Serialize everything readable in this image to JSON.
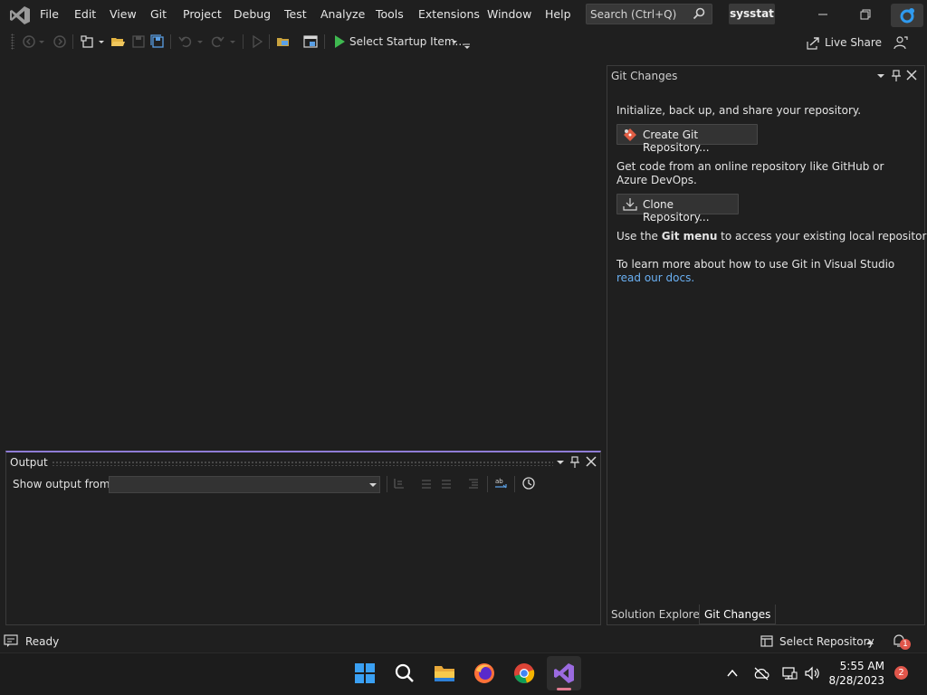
{
  "menu": {
    "items": [
      "File",
      "Edit",
      "View",
      "Git",
      "Project",
      "Debug",
      "Test",
      "Analyze",
      "Tools",
      "Extensions",
      "Window",
      "Help"
    ]
  },
  "search": {
    "label": "Search (Ctrl+Q)"
  },
  "solution_name": "sysstat",
  "toolbar": {
    "run_label": "Select Startup Item...",
    "live_share_label": "Live Share"
  },
  "git_panel": {
    "title": "Git Changes",
    "intro_text": "Initialize, back up, and share your repository.",
    "create_button": "Create Git Repository...",
    "clone_intro": "Get code from an online repository like GitHub or Azure DevOps.",
    "clone_button": "Clone Repository...",
    "menu_text_prefix": "Use the ",
    "menu_text_bold": "Git menu",
    "menu_text_suffix": " to access your existing local repositories.",
    "learn_text": "To learn more about how to use Git in Visual Studio",
    "docs_link": "read our docs.",
    "tabs": [
      "Solution Explorer",
      "Git Changes"
    ],
    "active_tab": "Git Changes"
  },
  "output": {
    "title": "Output",
    "show_from_label": "Show output from:",
    "source_value": ""
  },
  "status": {
    "ready": "Ready",
    "select_repository": "Select Repository",
    "notification_count": "1"
  },
  "taskbar": {
    "time": "5:55 AM",
    "date": "8/28/2023",
    "notification_count": "2"
  },
  "colors": {
    "accent": "#8f7cd6",
    "link": "#6ab0f3",
    "run_green": "#3fb950"
  }
}
